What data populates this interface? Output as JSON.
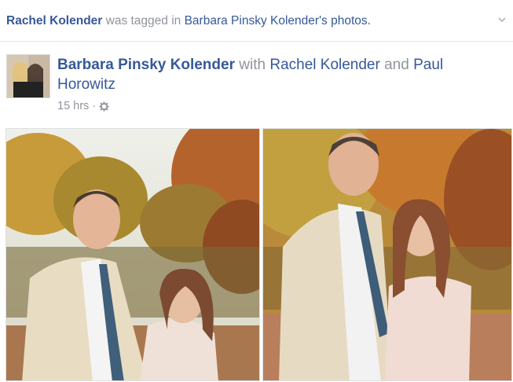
{
  "story": {
    "actor": "Rachel Kolender",
    "action": "was tagged in",
    "owner": "Barbara Pinsky Kolender",
    "suffix": "'s photos."
  },
  "post": {
    "author": "Barbara Pinsky Kolender",
    "with_text": "with",
    "tag1": "Rachel Kolender",
    "and_text": "and",
    "tag2": "Paul Horowitz",
    "time": "15 hrs",
    "separator": "·",
    "privacy_icon": "gear-icon"
  },
  "photos": [
    {
      "description_icon": "photo-couple-autumn-1"
    },
    {
      "description_icon": "photo-couple-autumn-2"
    }
  ],
  "colors": {
    "link": "#365899",
    "meta": "#90949c",
    "divider": "#e5e5e5"
  }
}
